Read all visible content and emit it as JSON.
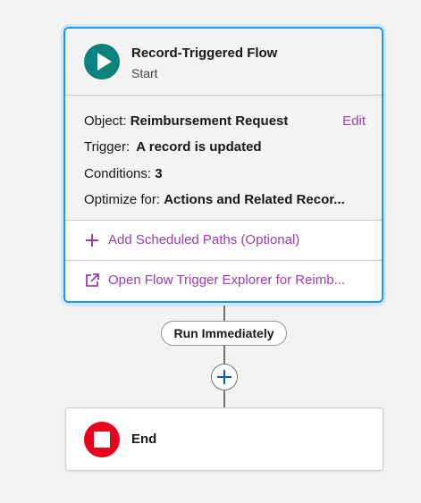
{
  "start_element": {
    "title": "Record-Triggered Flow",
    "subtitle": "Start",
    "details": {
      "object_label": "Object: ",
      "object_value": "Reimbursement Request",
      "edit_label": "Edit",
      "trigger_label": "Trigger: ",
      "trigger_value": "A record is updated",
      "conditions_label": "Conditions: ",
      "conditions_value": "3",
      "optimize_label": "Optimize for: ",
      "optimize_value": "Actions and Related Recor..."
    },
    "actions": {
      "scheduled_paths_label": "Add Scheduled Paths (Optional)",
      "trigger_explorer_label": "Open Flow Trigger Explorer for Reimb..."
    }
  },
  "path": {
    "run_label": "Run Immediately"
  },
  "end_element": {
    "label": "End"
  },
  "colors": {
    "start_icon": "#0b827c",
    "end_icon": "#ea001e",
    "link": "#9c3bb4",
    "selection_border": "#1b96ff"
  },
  "icons": {
    "start": "play-icon",
    "end": "stop-icon",
    "add_paths": "plus-icon",
    "explorer": "external-link-icon",
    "add_element": "plus-circle-icon"
  }
}
